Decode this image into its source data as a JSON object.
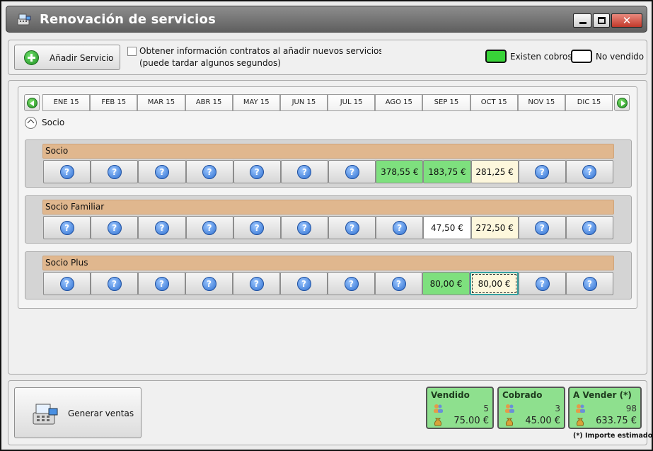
{
  "window": {
    "title": "Renovación de servicios",
    "close_glyph": "✕"
  },
  "toolbar": {
    "add_service_label": "Añadir Servicio",
    "info_line1": "Obtener información contratos al añadir nuevos servicios o naveg",
    "info_line2": "(puede tardar algunos segundos)",
    "info_checked": false
  },
  "legend": [
    {
      "label": "Existen cobros",
      "color": "#38d338"
    },
    {
      "label": "No vendido",
      "color": "#ffffff"
    }
  ],
  "months": [
    "ENE 15",
    "FEB 15",
    "MAR 15",
    "ABR 15",
    "MAY 15",
    "JUN 15",
    "JUL 15",
    "AGO 15",
    "SEP 15",
    "OCT 15",
    "NOV 15",
    "DIC 15"
  ],
  "group": {
    "label": "Socio"
  },
  "services": [
    {
      "name": "Socio",
      "cells": [
        {
          "type": "unknown"
        },
        {
          "type": "unknown"
        },
        {
          "type": "unknown"
        },
        {
          "type": "unknown"
        },
        {
          "type": "unknown"
        },
        {
          "type": "unknown"
        },
        {
          "type": "unknown"
        },
        {
          "type": "value",
          "text": "378,55 €",
          "status": "green"
        },
        {
          "type": "value",
          "text": "183,75 €",
          "status": "green"
        },
        {
          "type": "value",
          "text": "281,25 €",
          "status": "cream"
        },
        {
          "type": "unknown"
        },
        {
          "type": "unknown"
        }
      ]
    },
    {
      "name": "Socio Familiar",
      "cells": [
        {
          "type": "unknown"
        },
        {
          "type": "unknown"
        },
        {
          "type": "unknown"
        },
        {
          "type": "unknown"
        },
        {
          "type": "unknown"
        },
        {
          "type": "unknown"
        },
        {
          "type": "unknown"
        },
        {
          "type": "unknown"
        },
        {
          "type": "value",
          "text": "47,50 €",
          "status": "white"
        },
        {
          "type": "value",
          "text": "272,50 €",
          "status": "cream"
        },
        {
          "type": "unknown"
        },
        {
          "type": "unknown"
        }
      ]
    },
    {
      "name": "Socio Plus",
      "cells": [
        {
          "type": "unknown"
        },
        {
          "type": "unknown"
        },
        {
          "type": "unknown"
        },
        {
          "type": "unknown"
        },
        {
          "type": "unknown"
        },
        {
          "type": "unknown"
        },
        {
          "type": "unknown"
        },
        {
          "type": "unknown"
        },
        {
          "type": "value",
          "text": "80,00 €",
          "status": "green"
        },
        {
          "type": "value",
          "text": "80,00 €",
          "status": "cream",
          "focused": true
        },
        {
          "type": "unknown"
        },
        {
          "type": "unknown"
        }
      ]
    }
  ],
  "bottom": {
    "generate_label": "Generar ventas",
    "stats": [
      {
        "title": "Vendido",
        "count": "5",
        "amount": "75.00 €"
      },
      {
        "title": "Cobrado",
        "count": "3",
        "amount": "45.00 €"
      },
      {
        "title": "A Vender (*)",
        "count": "98",
        "amount": "633.75 €"
      }
    ],
    "footnote": "(*) Importe estimado"
  },
  "icons": {
    "unknown_glyph": "?"
  }
}
